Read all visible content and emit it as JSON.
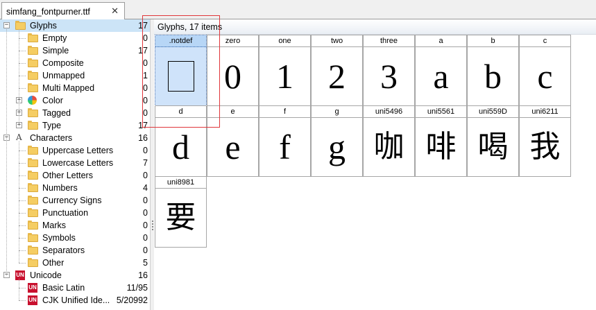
{
  "tab": {
    "title": "simfang_fontpurner.ttf",
    "close": "✕"
  },
  "tree": [
    {
      "label": "Glyphs",
      "count": "17",
      "level": 0,
      "icon": "folder",
      "expander": "−",
      "selected": true
    },
    {
      "label": "Empty",
      "count": "0",
      "level": 1,
      "icon": "folder"
    },
    {
      "label": "Simple",
      "count": "17",
      "level": 1,
      "icon": "folder"
    },
    {
      "label": "Composite",
      "count": "0",
      "level": 1,
      "icon": "folder"
    },
    {
      "label": "Unmapped",
      "count": "1",
      "level": 1,
      "icon": "folder"
    },
    {
      "label": "Multi Mapped",
      "count": "0",
      "level": 1,
      "icon": "folder"
    },
    {
      "label": "Color",
      "count": "0",
      "level": 1,
      "icon": "color",
      "expander": "+"
    },
    {
      "label": "Tagged",
      "count": "0",
      "level": 1,
      "icon": "folder",
      "expander": "+"
    },
    {
      "label": "Type",
      "count": "17",
      "level": 1,
      "icon": "folder",
      "expander": "+"
    },
    {
      "label": "Characters",
      "count": "16",
      "level": 0,
      "icon": "char",
      "expander": "−"
    },
    {
      "label": "Uppercase Letters",
      "count": "0",
      "level": 1,
      "icon": "folder"
    },
    {
      "label": "Lowercase Letters",
      "count": "7",
      "level": 1,
      "icon": "folder"
    },
    {
      "label": "Other Letters",
      "count": "0",
      "level": 1,
      "icon": "folder"
    },
    {
      "label": "Numbers",
      "count": "4",
      "level": 1,
      "icon": "folder"
    },
    {
      "label": "Currency Signs",
      "count": "0",
      "level": 1,
      "icon": "folder"
    },
    {
      "label": "Punctuation",
      "count": "0",
      "level": 1,
      "icon": "folder"
    },
    {
      "label": "Marks",
      "count": "0",
      "level": 1,
      "icon": "folder"
    },
    {
      "label": "Symbols",
      "count": "0",
      "level": 1,
      "icon": "folder"
    },
    {
      "label": "Separators",
      "count": "0",
      "level": 1,
      "icon": "folder"
    },
    {
      "label": "Other",
      "count": "5",
      "level": 1,
      "icon": "folder"
    },
    {
      "label": "Unicode",
      "count": "16",
      "level": 0,
      "icon": "unicode",
      "expander": "−"
    },
    {
      "label": "Basic Latin",
      "count": "11/95",
      "level": 1,
      "icon": "unicode"
    },
    {
      "label": "CJK Unified Ide...",
      "count": "5/20992",
      "level": 1,
      "icon": "unicode"
    }
  ],
  "icons": {
    "char_glyph": "A",
    "unicode_glyph": "UN"
  },
  "panel": {
    "title": "Glyphs, 17 items"
  },
  "glyphs": [
    {
      "name": ".notdef",
      "char": "",
      "kind": "notdef",
      "selected": true
    },
    {
      "name": "zero",
      "char": "0",
      "kind": "latin"
    },
    {
      "name": "one",
      "char": "1",
      "kind": "latin"
    },
    {
      "name": "two",
      "char": "2",
      "kind": "latin"
    },
    {
      "name": "three",
      "char": "3",
      "kind": "latin"
    },
    {
      "name": "a",
      "char": "a",
      "kind": "latin"
    },
    {
      "name": "b",
      "char": "b",
      "kind": "latin"
    },
    {
      "name": "c",
      "char": "c",
      "kind": "latin"
    },
    {
      "name": "d",
      "char": "d",
      "kind": "latin"
    },
    {
      "name": "e",
      "char": "e",
      "kind": "latin"
    },
    {
      "name": "f",
      "char": "f",
      "kind": "latin"
    },
    {
      "name": "g",
      "char": "g",
      "kind": "latin"
    },
    {
      "name": "uni5496",
      "char": "咖",
      "kind": "cjk"
    },
    {
      "name": "uni5561",
      "char": "啡",
      "kind": "cjk"
    },
    {
      "name": "uni559D",
      "char": "喝",
      "kind": "cjk"
    },
    {
      "name": "uni6211",
      "char": "我",
      "kind": "cjk"
    },
    {
      "name": "uni8981",
      "char": "要",
      "kind": "cjk"
    }
  ],
  "colors": {
    "selection": "#cce4f7",
    "annotation": "#e0363a",
    "folder": "#f5cd63"
  }
}
